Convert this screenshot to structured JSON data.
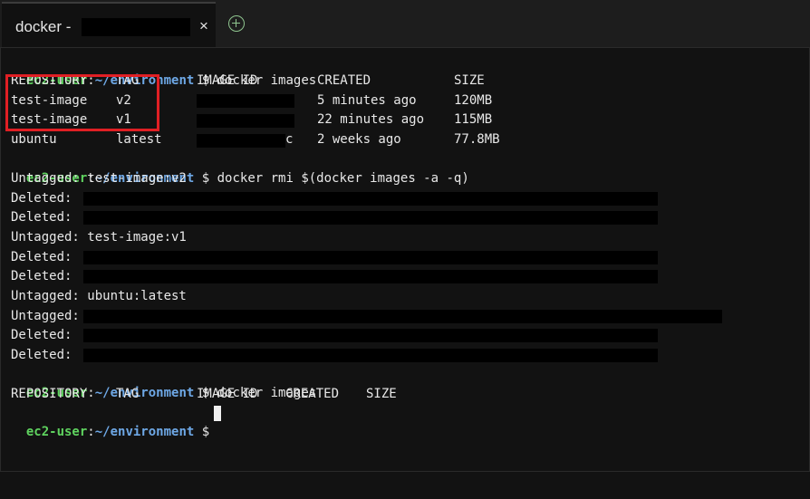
{
  "tab": {
    "title": "docker - ",
    "close": "×"
  },
  "prompt": {
    "user": "ec2-user",
    "colon": ":",
    "path": "~/environment",
    "sign": " $ "
  },
  "commands": [
    "docker images",
    "docker rmi $(docker images -a -q)",
    "docker images"
  ],
  "images_table1": {
    "headers": [
      "REPOSITORY",
      "TAG",
      "IMAGE ID",
      "CREATED",
      "SIZE"
    ],
    "rows": [
      [
        "test-image",
        "v2",
        "",
        "5 minutes ago",
        "120MB"
      ],
      [
        "test-image",
        "v1",
        "",
        "22 minutes ago",
        "115MB"
      ],
      [
        "ubuntu",
        "latest",
        "c",
        "2 weeks ago",
        "77.8MB"
      ]
    ]
  },
  "rmi_output": [
    "Untagged: test-image:v2",
    "Deleted: ",
    "Deleted: ",
    "Untagged: test-image:v1",
    "Deleted: ",
    "Deleted: ",
    "Untagged: ubuntu:latest",
    "Untagged: ",
    "Deleted: ",
    "Deleted: "
  ],
  "images_table2": {
    "headers": [
      "REPOSITORY",
      "TAG",
      "IMAGE ID",
      "CREATED",
      "SIZE"
    ]
  },
  "colors": {
    "background": "#121212",
    "prompt_user": "#5fd35f",
    "prompt_path": "#6ea8e6",
    "highlight": "#e01f24"
  }
}
